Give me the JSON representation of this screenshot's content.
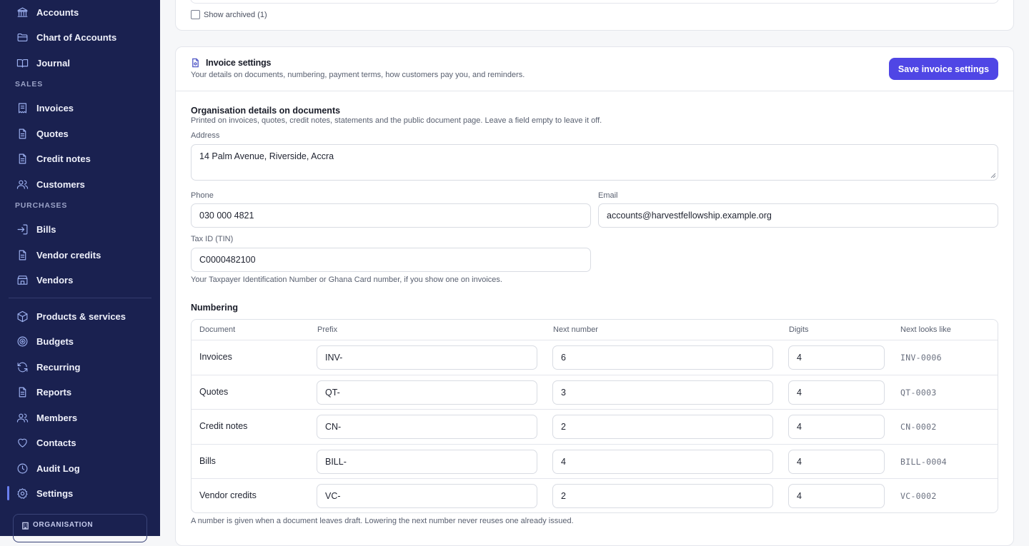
{
  "sidebar": {
    "items_top": [
      {
        "label": "Accounts",
        "icon": "bank-icon"
      },
      {
        "label": "Chart of Accounts",
        "icon": "folder-icon"
      },
      {
        "label": "Journal",
        "icon": "book-icon"
      }
    ],
    "sales_label": "SALES",
    "sales_items": [
      {
        "label": "Invoices",
        "icon": "receipt-icon"
      },
      {
        "label": "Quotes",
        "icon": "document-icon"
      },
      {
        "label": "Credit notes",
        "icon": "document-icon"
      },
      {
        "label": "Customers",
        "icon": "users-icon"
      }
    ],
    "purchases_label": "PURCHASES",
    "purchase_items": [
      {
        "label": "Bills",
        "icon": "login-icon"
      },
      {
        "label": "Vendor credits",
        "icon": "document-icon"
      },
      {
        "label": "Vendors",
        "icon": "store-icon"
      }
    ],
    "other_items": [
      {
        "label": "Products & services",
        "icon": "box-icon"
      },
      {
        "label": "Budgets",
        "icon": "target-icon"
      },
      {
        "label": "Recurring",
        "icon": "refresh-icon"
      },
      {
        "label": "Reports",
        "icon": "document-icon"
      },
      {
        "label": "Members",
        "icon": "users-icon"
      },
      {
        "label": "Contacts",
        "icon": "heart-icon"
      },
      {
        "label": "Audit Log",
        "icon": "clock-icon"
      },
      {
        "label": "Settings",
        "icon": "gear-icon"
      }
    ],
    "active": "Settings",
    "org_label": "ORGANISATION"
  },
  "accounts_card": {
    "show_archived_label": "Show archived (1)",
    "show_archived_checked": false
  },
  "invoice_settings": {
    "title": "Invoice settings",
    "subtitle": "Your details on documents, numbering, payment terms, how customers pay you, and reminders.",
    "save_label": "Save invoice settings",
    "org_details": {
      "heading": "Organisation details on documents",
      "description": "Printed on invoices, quotes, credit notes, statements and the public document page. Leave a field empty to leave it off.",
      "address_label": "Address",
      "address_value": "14 Palm Avenue, Riverside, Accra",
      "phone_label": "Phone",
      "phone_value": "030 000 4821",
      "email_label": "Email",
      "email_value": "accounts@harvestfellowship.example.org",
      "tax_label": "Tax ID (TIN)",
      "tax_value": "C0000482100",
      "tax_help": "Your Taxpayer Identification Number or Ghana Card number, if you show one on invoices."
    },
    "numbering": {
      "heading": "Numbering",
      "columns": {
        "document": "Document",
        "prefix": "Prefix",
        "next_number": "Next number",
        "digits": "Digits",
        "next_looks_like": "Next looks like"
      },
      "rows": [
        {
          "document": "Invoices",
          "prefix": "INV-",
          "next": "6",
          "digits": "4",
          "preview": "INV-0006"
        },
        {
          "document": "Quotes",
          "prefix": "QT-",
          "next": "3",
          "digits": "4",
          "preview": "QT-0003"
        },
        {
          "document": "Credit notes",
          "prefix": "CN-",
          "next": "2",
          "digits": "4",
          "preview": "CN-0002"
        },
        {
          "document": "Bills",
          "prefix": "BILL-",
          "next": "4",
          "digits": "4",
          "preview": "BILL-0004"
        },
        {
          "document": "Vendor credits",
          "prefix": "VC-",
          "next": "2",
          "digits": "4",
          "preview": "VC-0002"
        }
      ],
      "footnote": "A number is given when a document leaves draft. Lowering the next number never reuses one already issued."
    }
  },
  "colors": {
    "sidebar_bg": "#1a2150",
    "accent": "#4f46e5",
    "icon_tint": "#9fb3f2"
  }
}
